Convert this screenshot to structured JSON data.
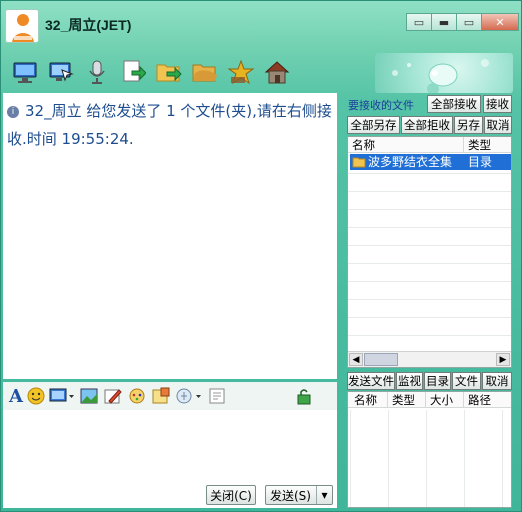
{
  "window": {
    "title": "32_周立(JET)",
    "controls": {
      "menu_glyph": "▭",
      "minimize_glyph": "▬",
      "maximize_glyph": "▭",
      "close_glyph": "✕"
    }
  },
  "toolbar": {
    "icons": [
      "remote-desktop-icon",
      "remote-assist-icon",
      "voice-icon",
      "send-file-icon",
      "send-folder-icon",
      "shared-folder-icon",
      "favorites-icon",
      "home-icon"
    ]
  },
  "chat": {
    "message": "32_周立 给您发送了 1 个文件(夹),请在右侧接收.时间 19:55:24."
  },
  "format_toolbar": {
    "icons": [
      "font-icon",
      "emoji-icon",
      "screenshot-icon",
      "image-icon",
      "handwrite-icon",
      "shake-icon",
      "sticky-icon",
      "voice-msg-icon",
      "history-icon",
      "lock-icon"
    ]
  },
  "bottom_buttons": {
    "close": "关闭(C)",
    "send": "发送(S)",
    "send_dropdown": "▾"
  },
  "receive_panel": {
    "label": "要接收的文件",
    "buttons": {
      "accept_all": "全部接收",
      "accept": "接收",
      "save_all_as": "全部另存",
      "reject_all": "全部拒收",
      "save_as": "另存",
      "cancel": "取消"
    },
    "columns": [
      "名称",
      "类型"
    ],
    "files": [
      {
        "name": "波多野结衣全集",
        "type": "目录"
      }
    ]
  },
  "send_panel": {
    "buttons": {
      "send_file": "发送文件",
      "monitor": "监视",
      "directory": "目录",
      "file": "文件",
      "cancel": "取消"
    },
    "columns": [
      "名称",
      "类型",
      "大小",
      "路径"
    ]
  }
}
